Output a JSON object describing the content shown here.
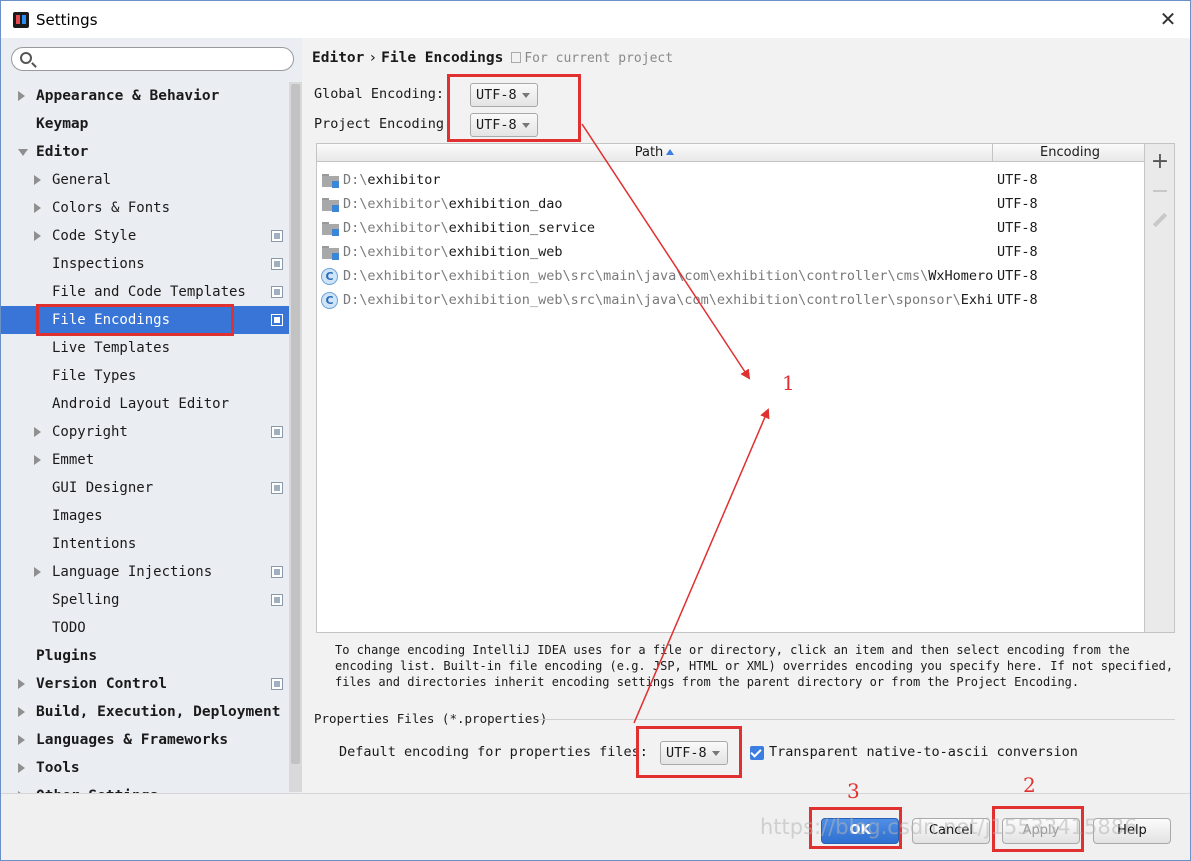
{
  "window": {
    "title": "Settings"
  },
  "search": {
    "placeholder": ""
  },
  "sidebar": {
    "items": [
      {
        "label": "Appearance & Behavior",
        "level": 0,
        "arrow": "closed",
        "bold": true,
        "project": false,
        "selected": false
      },
      {
        "label": "Keymap",
        "level": 0,
        "arrow": "none",
        "bold": true,
        "project": false,
        "selected": false
      },
      {
        "label": "Editor",
        "level": 0,
        "arrow": "open",
        "bold": true,
        "project": false,
        "selected": false
      },
      {
        "label": "General",
        "level": 1,
        "arrow": "closed",
        "bold": false,
        "project": false,
        "selected": false
      },
      {
        "label": "Colors & Fonts",
        "level": 1,
        "arrow": "closed",
        "bold": false,
        "project": false,
        "selected": false
      },
      {
        "label": "Code Style",
        "level": 1,
        "arrow": "closed",
        "bold": false,
        "project": true,
        "selected": false
      },
      {
        "label": "Inspections",
        "level": 1,
        "arrow": "none",
        "bold": false,
        "project": true,
        "selected": false
      },
      {
        "label": "File and Code Templates",
        "level": 1,
        "arrow": "none",
        "bold": false,
        "project": true,
        "selected": false
      },
      {
        "label": "File Encodings",
        "level": 1,
        "arrow": "none",
        "bold": false,
        "project": true,
        "selected": true
      },
      {
        "label": "Live Templates",
        "level": 1,
        "arrow": "none",
        "bold": false,
        "project": false,
        "selected": false
      },
      {
        "label": "File Types",
        "level": 1,
        "arrow": "none",
        "bold": false,
        "project": false,
        "selected": false
      },
      {
        "label": "Android Layout Editor",
        "level": 1,
        "arrow": "none",
        "bold": false,
        "project": false,
        "selected": false
      },
      {
        "label": "Copyright",
        "level": 1,
        "arrow": "closed",
        "bold": false,
        "project": true,
        "selected": false
      },
      {
        "label": "Emmet",
        "level": 1,
        "arrow": "closed",
        "bold": false,
        "project": false,
        "selected": false
      },
      {
        "label": "GUI Designer",
        "level": 1,
        "arrow": "none",
        "bold": false,
        "project": true,
        "selected": false
      },
      {
        "label": "Images",
        "level": 1,
        "arrow": "none",
        "bold": false,
        "project": false,
        "selected": false
      },
      {
        "label": "Intentions",
        "level": 1,
        "arrow": "none",
        "bold": false,
        "project": false,
        "selected": false
      },
      {
        "label": "Language Injections",
        "level": 1,
        "arrow": "closed",
        "bold": false,
        "project": true,
        "selected": false
      },
      {
        "label": "Spelling",
        "level": 1,
        "arrow": "none",
        "bold": false,
        "project": true,
        "selected": false
      },
      {
        "label": "TODO",
        "level": 1,
        "arrow": "none",
        "bold": false,
        "project": false,
        "selected": false
      },
      {
        "label": "Plugins",
        "level": 0,
        "arrow": "none",
        "bold": true,
        "project": false,
        "selected": false
      },
      {
        "label": "Version Control",
        "level": 0,
        "arrow": "closed",
        "bold": true,
        "project": true,
        "selected": false
      },
      {
        "label": "Build, Execution, Deployment",
        "level": 0,
        "arrow": "closed",
        "bold": true,
        "project": false,
        "selected": false
      },
      {
        "label": "Languages & Frameworks",
        "level": 0,
        "arrow": "closed",
        "bold": true,
        "project": false,
        "selected": false
      },
      {
        "label": "Tools",
        "level": 0,
        "arrow": "closed",
        "bold": true,
        "project": false,
        "selected": false
      },
      {
        "label": "Other Settings",
        "level": 0,
        "arrow": "closed",
        "bold": true,
        "project": false,
        "selected": false
      }
    ]
  },
  "breadcrumb": {
    "parent": "Editor",
    "separator": "›",
    "current": "File Encodings",
    "scope": "For current project"
  },
  "encodings": {
    "global_label": "Global Encoding:",
    "global_value": "UTF-8",
    "project_label": "Project Encoding:",
    "project_value": "UTF-8"
  },
  "table": {
    "columns": {
      "path": "Path",
      "encoding": "Encoding"
    },
    "rows": [
      {
        "icon": "folder",
        "path_dim": "D:\\",
        "path_main": "exhibitor",
        "encoding": "UTF-8"
      },
      {
        "icon": "folder",
        "path_dim": "D:\\exhibitor\\",
        "path_main": "exhibition_dao",
        "encoding": "UTF-8"
      },
      {
        "icon": "folder",
        "path_dim": "D:\\exhibitor\\",
        "path_main": "exhibition_service",
        "encoding": "UTF-8"
      },
      {
        "icon": "folder",
        "path_dim": "D:\\exhibitor\\",
        "path_main": "exhibition_web",
        "encoding": "UTF-8"
      },
      {
        "icon": "class",
        "path_dim": "D:\\exhibitor\\exhibition_web\\src\\main\\java\\com\\exhibition\\controller\\cms\\",
        "path_main": "WxHomerotation",
        "encoding": "UTF-8"
      },
      {
        "icon": "class",
        "path_dim": "D:\\exhibitor\\exhibition_web\\src\\main\\java\\com\\exhibition\\controller\\sponsor\\",
        "path_main": "Exhibition",
        "encoding": "UTF-8"
      }
    ],
    "class_letter": "C"
  },
  "toolbar": {
    "add_label": "+"
  },
  "hint": "To change encoding IntelliJ IDEA uses for a file or directory, click an item and then select encoding from the encoding list. Built-in file encoding (e.g. JSP, HTML or XML) overrides encoding you specify here. If not specified, files and directories inherit encoding settings from the parent directory or from the Project Encoding.",
  "properties": {
    "section_title": "Properties Files (*.properties)",
    "default_label": "Default encoding for properties files:",
    "default_value": "UTF-8",
    "native_to_ascii_label": "Transparent native-to-ascii conversion",
    "native_to_ascii_checked": true
  },
  "buttons": {
    "ok": "OK",
    "cancel": "Cancel",
    "apply": "Apply",
    "help": "Help"
  },
  "annotations": {
    "step1": "1",
    "step2": "2",
    "step3": "3",
    "color": "#e03030"
  },
  "watermark": "https://blog.csdn.net/j15533415886",
  "colors": {
    "selection": "#3875d6",
    "primary_button": "#2f6fcf"
  }
}
